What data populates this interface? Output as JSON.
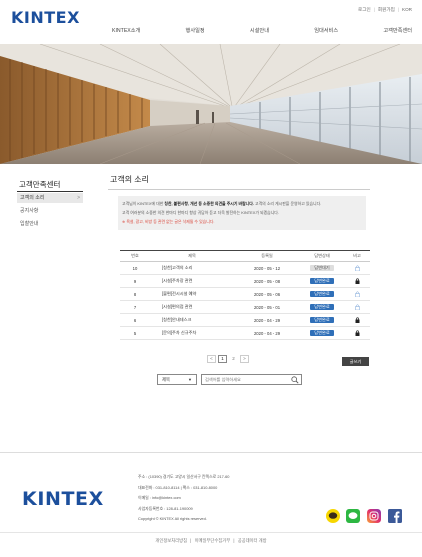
{
  "header": {
    "logo": "KINTEX",
    "util": [
      "로그인",
      "회원가입",
      "KOR"
    ],
    "nav": [
      "KINTEX소개",
      "행사일정",
      "시설안내",
      "임대서비스",
      "고객만족센터"
    ]
  },
  "sidebar": {
    "title": "고객만족센터",
    "items": [
      {
        "label": "고객의 소리",
        "arrow": ">"
      },
      {
        "label": "공지사항"
      },
      {
        "label": "입찰안내"
      }
    ]
  },
  "page": {
    "title": "고객의 소리",
    "notice": {
      "line1_pre": "고객님이 KINTEX에 대한 ",
      "line1_bold": "칭찬, 불편사항, 개선 등 소중한 의견을 주시기 바랍니다.",
      "line1_post": " 고객의 소리 게시판을 운영하고 있습니다.",
      "line2": "고객 여러분의 소중한 의견 한마디 한마디 항상 귀담아 듣고 더욱 발전하는 KINTEX가 되겠습니다.",
      "line3": "※ 욕설, 광고, 비방 등 관련 없는 글은 삭제될 수 있습니다."
    }
  },
  "table": {
    "headers": [
      "번호",
      "제목",
      "등록일",
      "답변상태",
      "비고"
    ],
    "rows": [
      {
        "no": "10",
        "subject": "[칭찬]고객의 소리",
        "date": "2020 - 05 - 12",
        "status": "답변대기",
        "done": false,
        "lock": false
      },
      {
        "no": "9",
        "subject": "[시설]주차장 관련",
        "date": "2020 - 05 - 08",
        "status": "답변완료",
        "done": true,
        "lock": true
      },
      {
        "no": "8",
        "subject": "[불편]전시시설 예약",
        "date": "2020 - 05 - 06",
        "status": "답변완료",
        "done": true,
        "lock": false
      },
      {
        "no": "7",
        "subject": "[시설]편의점 관련",
        "date": "2020 - 05 - 01",
        "status": "답변완료",
        "done": true,
        "lock": false
      },
      {
        "no": "6",
        "subject": "[칭찬]안내데스크",
        "date": "2020 - 04 - 29",
        "status": "답변완료",
        "done": true,
        "lock": true
      },
      {
        "no": "5",
        "subject": "[문의]주차 신규주차",
        "date": "2020 - 04 - 29",
        "status": "답변완료",
        "done": true,
        "lock": true
      }
    ]
  },
  "pagination": {
    "prev": "<",
    "next": ">",
    "pages": [
      "1",
      "2"
    ],
    "current": "1"
  },
  "write_button": "글쓰기",
  "search": {
    "select_value": "제목",
    "placeholder": "검색어를 입력하세요"
  },
  "footer": {
    "logo": "KINTEX",
    "info": [
      "주소 : (10390) 경기도 고양시 일산서구 킨텍스로 217-60",
      "대표전화 : 031-810-8114 | 팩스 : 031-810-8000",
      "이메일 : info@kintex.com",
      "사업자등록번호 : 128-81-190009",
      "Copyright © KINTEX All rights reserved."
    ],
    "links": [
      "개인정보처리방침",
      "이메일무단수집거부",
      "공공데이터 개방"
    ],
    "sns": [
      "kakaotalk-icon",
      "line-icon",
      "instagram-icon",
      "facebook-icon"
    ]
  },
  "colors": {
    "brand": "#1c4f9c",
    "status_done": "#2f6fb8",
    "warning": "#d9463a"
  }
}
